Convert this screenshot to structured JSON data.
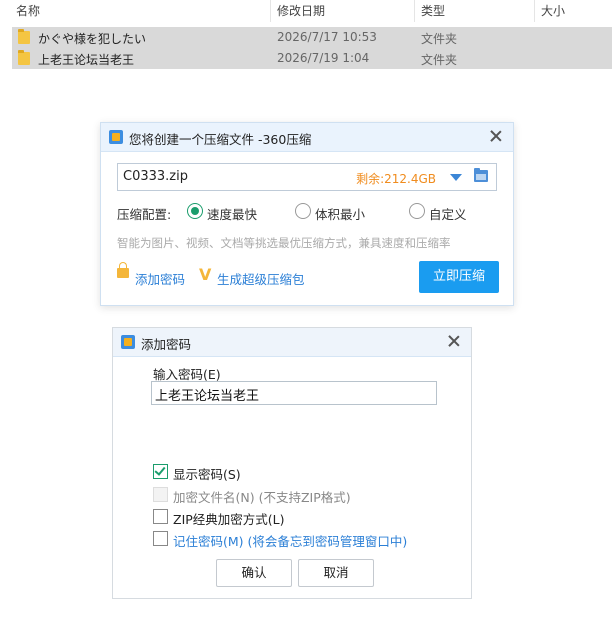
{
  "explorer": {
    "columns": [
      "名称",
      "修改日期",
      "类型",
      "大小"
    ],
    "rows": [
      {
        "name": "かぐや様を犯したい",
        "date": "2026/7/17 10:53",
        "type": "文件夹"
      },
      {
        "name": "上老王论坛当老王",
        "date": "2026/7/19 1:04",
        "type": "文件夹"
      }
    ]
  },
  "compress_dialog": {
    "title": "您将创建一个压缩文件 -360压缩",
    "filename": "C0333.zip",
    "free_space": "剩余:212.4GB",
    "config_label": "压缩配置:",
    "options": [
      "速度最快",
      "体积最小",
      "自定义"
    ],
    "selected_option": "速度最快",
    "description": "智能为图片、视频、文档等挑选最优压缩方式，兼具速度和压缩率",
    "add_password": "添加密码",
    "super_package": "生成超级压缩包",
    "compress_button": "立即压缩",
    "accent_color": "#1a9cf0"
  },
  "password_dialog": {
    "title": "添加密码",
    "input_label": "输入密码(E)",
    "password_value": "上老王论坛当老王",
    "checkboxes": [
      {
        "label": "显示密码(S)",
        "checked": true,
        "disabled": false
      },
      {
        "label": "加密文件名(N) (不支持ZIP格式)",
        "checked": false,
        "disabled": true
      },
      {
        "label": "ZIP经典加密方式(L)",
        "checked": false,
        "disabled": false
      },
      {
        "label": "记住密码(M) (将会备忘到密码管理窗口中)",
        "checked": false,
        "disabled": false
      }
    ],
    "ok_button": "确认",
    "cancel_button": "取消"
  }
}
